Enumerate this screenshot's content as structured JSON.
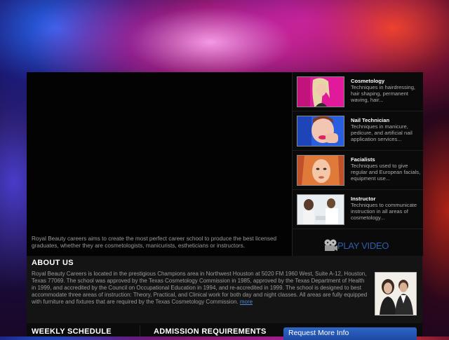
{
  "hero": {
    "text": "Royal Beauty careers aims to create the most perfect career school to produce the best licensed graduates, whether they are cosmetologists, manicurists, estheticians or instructors."
  },
  "courses": [
    {
      "title": "Cosmetology",
      "desc": "Techniques in hairdressing, hair shaping, permanent waving, hair..."
    },
    {
      "title": "Nail Technician",
      "desc": "Techniques in manicure, pedicure, and artificial nail application services..."
    },
    {
      "title": "Facialists",
      "desc": "Techniques used to give regular and European facials, equipment use..."
    },
    {
      "title": "Instructor",
      "desc": "Techniques to communicate instruction in all areas of cosmetology..."
    }
  ],
  "play_video": {
    "label": "PLAY VIDEO",
    "icon": "film-reel-icon"
  },
  "about": {
    "heading": "ABOUT US",
    "body": "Royal Beauty Careers is located in the prestigious Champions area in Northwest Houston at 5020 FM 1960 West, Suite A-12, Houston, Texas 77069. The school was approved by the Texas Cosmetology Commission in 1985, approved by the Texas Department of Health in 1999, and accredited by the Council on Occupational Education in 1994, and re-accredited in 1999. The school is designed to best accommodate three areas of instruction: Theory, Practical, and Clinical work for both day and night classes. All areas are fully equipped with furniture and fixtures that are required by the Texas Cosmetology Commission.",
    "more": "more"
  },
  "bottom": {
    "weekly": "WEEKLY SCHEDULE",
    "admission": "ADMISSION REQUIREMENTS",
    "request": "Request More Info"
  },
  "colors": {
    "accent": "#2e5fae",
    "link": "#4a8ad6",
    "button": "#2456b4"
  }
}
